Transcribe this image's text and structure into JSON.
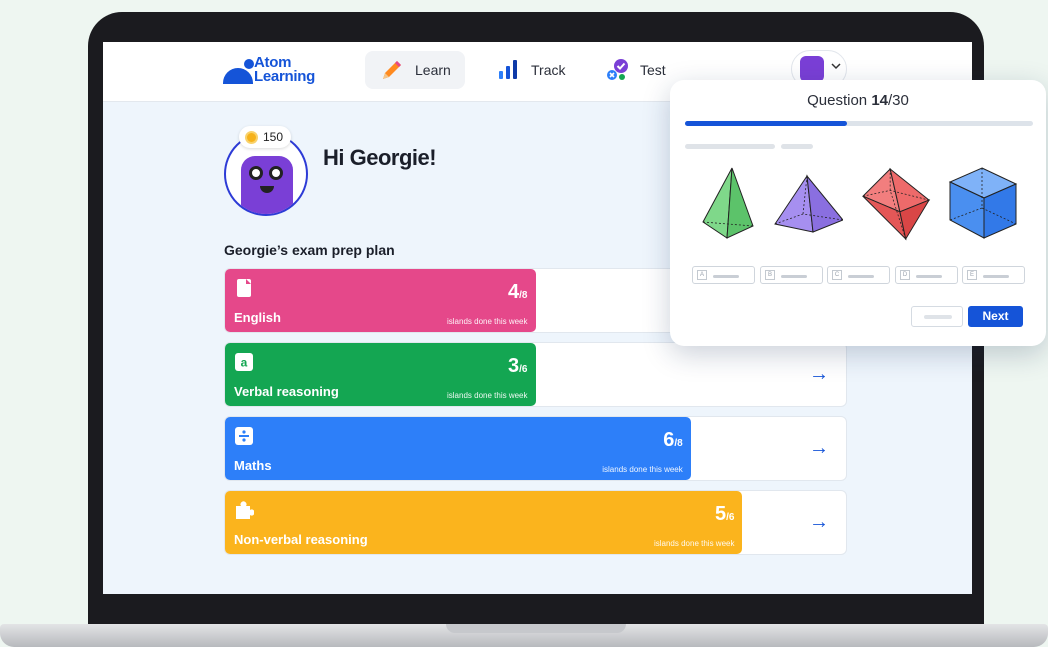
{
  "brand": {
    "name_line1": "Atom",
    "name_line2": "Learning",
    "color": "#1554d8"
  },
  "nav": {
    "tabs": [
      {
        "label": "Learn",
        "icon": "pencil-icon",
        "active": true
      },
      {
        "label": "Track",
        "icon": "bar-chart-icon",
        "active": false
      },
      {
        "label": "Test",
        "icon": "test-icon",
        "active": false
      }
    ],
    "account": {
      "icon": "avatar-icon",
      "menu_icon": "chevron-down-icon"
    }
  },
  "profile": {
    "coins": "150",
    "greeting": "Hi Georgie!"
  },
  "plan": {
    "title": "Georgie’s exam prep plan",
    "caption": "islands done this week",
    "subjects": [
      {
        "name": "English",
        "icon": "book-icon",
        "done": "4",
        "total": "/8",
        "progress": 0.5,
        "color": "#e5488a",
        "arrow": "→"
      },
      {
        "name": "Verbal reasoning",
        "icon": "letter-a-icon",
        "done": "3",
        "total": "/6",
        "progress": 0.5,
        "color": "#14a652",
        "arrow": "→"
      },
      {
        "name": "Maths",
        "icon": "divide-icon",
        "done": "6",
        "total": "/8",
        "progress": 0.75,
        "color": "#2d7ff9",
        "arrow": "→"
      },
      {
        "name": "Non-verbal reasoning",
        "icon": "puzzle-icon",
        "done": "5",
        "total": "/6",
        "progress": 0.8333,
        "color": "#fbb41d",
        "arrow": "→"
      }
    ]
  },
  "question": {
    "label": "Question ",
    "current": "14",
    "total": "/30",
    "progress": 0.4667,
    "options": [
      "A",
      "B",
      "C",
      "D",
      "E"
    ],
    "next_label": "Next"
  }
}
